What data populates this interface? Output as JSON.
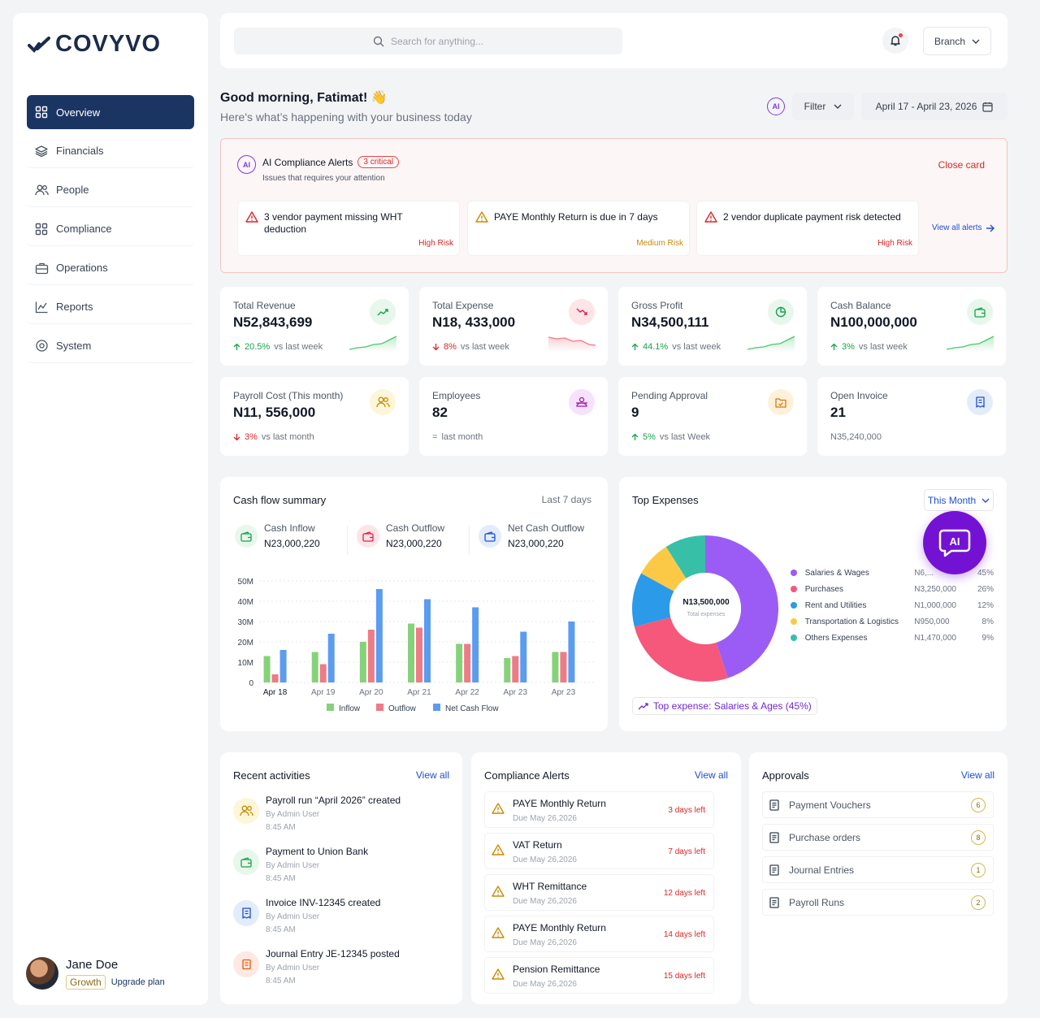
{
  "brand": {
    "name": "COVYVO",
    "accent": "#1b3563",
    "ai_color": "#7c3aed"
  },
  "sidebar": {
    "items": [
      {
        "label": "Overview",
        "icon": "grid-icon",
        "active": true
      },
      {
        "label": "Financials",
        "icon": "layers-icon"
      },
      {
        "label": "People",
        "icon": "users-icon"
      },
      {
        "label": "Compliance",
        "icon": "grid-icon"
      },
      {
        "label": "Operations",
        "icon": "briefcase-icon"
      },
      {
        "label": "Reports",
        "icon": "chart-line-icon"
      },
      {
        "label": "System",
        "icon": "settings-icon"
      }
    ]
  },
  "user": {
    "name": "Jane Doe",
    "plan": "Growth",
    "upgrade": "Upgrade plan"
  },
  "topbar": {
    "search_placeholder": "Search for anything...",
    "branch": "Branch"
  },
  "greeting": {
    "title": "Good morning, Fatimat! 👋",
    "subtitle": "Here's what’s happening with your business today"
  },
  "controls": {
    "ai": "AI",
    "filter": "Filter",
    "date_range": "April 17 - April 23, 2026"
  },
  "ai_alerts": {
    "ai": "AI",
    "title": "AI Compliance Alerts",
    "badge": "3 critical",
    "subtitle": "Issues that requires your attention",
    "close": "Close card",
    "view_all": "View all alerts",
    "items": [
      {
        "text": "3 vendor payment missing WHT deduction",
        "risk": "High Risk",
        "color": "#dc2626"
      },
      {
        "text": "PAYE Monthly Return is due in 7 days",
        "risk": "Medium Risk",
        "color": "#ca8a04"
      },
      {
        "text": "2 vendor duplicate payment risk detected",
        "risk": "High Risk",
        "color": "#dc2626"
      }
    ]
  },
  "kpis": [
    {
      "label": "Total Revenue",
      "value": "N52,843,699",
      "change": "20.5%",
      "note": "vs last week",
      "trend": "up",
      "icon": "trend-up-icon"
    },
    {
      "label": "Total Expense",
      "value": "N18, 433,000",
      "change": "8%",
      "note": "vs last week",
      "trend": "down",
      "icon": "trend-down-icon"
    },
    {
      "label": "Gross Profit",
      "value": "N34,500,111",
      "change": "44.1%",
      "note": "vs last week",
      "trend": "up",
      "icon": "pie-icon"
    },
    {
      "label": "Cash Balance",
      "value": "N100,000,000",
      "change": "3%",
      "note": "vs last week",
      "trend": "up",
      "icon": "wallet-icon"
    },
    {
      "label": "Payroll Cost (This month)",
      "value": "N11, 556,000",
      "change": "3%",
      "note": "vs last month",
      "trend": "down",
      "icon": "users-icon"
    },
    {
      "label": "Employees",
      "value": "82",
      "change": "=",
      "note": "last month",
      "trend": "flat",
      "icon": "employees-icon"
    },
    {
      "label": "Pending Approval",
      "value": "9",
      "change": "5%",
      "note": "vs last Week",
      "trend": "up",
      "icon": "folder-check-icon"
    },
    {
      "label": "Open Invoice",
      "value": "21",
      "change": "",
      "note": "N35,240,000",
      "trend": "none",
      "icon": "invoice-icon"
    }
  ],
  "cashflow": {
    "title": "Cash flow summary",
    "range": "Last 7 days",
    "stats": [
      {
        "label": "Cash Inflow",
        "value": "N23,000,220"
      },
      {
        "label": "Cash Outflow",
        "value": "N23,000,220"
      },
      {
        "label": "Net Cash Outflow",
        "value": "N23,000,220"
      }
    ]
  },
  "chart_data": {
    "type": "bar",
    "categories": [
      "Apr 18",
      "Apr 19",
      "Apr 20",
      "Apr 21",
      "Apr 22",
      "Apr 23",
      "Apr 23"
    ],
    "series": [
      {
        "name": "Inflow",
        "values": [
          13,
          15,
          20,
          29,
          19,
          12,
          15
        ],
        "color": "#86d27a"
      },
      {
        "name": "Outflow",
        "values": [
          4,
          9,
          26,
          27,
          19,
          13,
          15
        ],
        "color": "#ef7b86"
      },
      {
        "name": "Net Cash Flow",
        "values": [
          16,
          24,
          46,
          41,
          37,
          25,
          30
        ],
        "color": "#5b9cf1"
      }
    ],
    "yticks": [
      "0",
      "10M",
      "20M",
      "30M",
      "40M",
      "50M"
    ],
    "ylim": [
      0,
      50
    ],
    "legend": "bottom"
  },
  "top_expenses": {
    "title": "Top Expenses",
    "period": "This Month",
    "center_value": "N13,500,000",
    "center_label": "Total expenses",
    "insight": "Top expense: Salaries & Ages (45%)",
    "ai": "AI",
    "slices": [
      {
        "name": "Salaries & Wages",
        "value": "N6,...",
        "pct": "45%",
        "share": 45,
        "color": "#9b5cf6"
      },
      {
        "name": "Purchases",
        "value": "N3,250,000",
        "pct": "26%",
        "share": 26,
        "color": "#f5587a"
      },
      {
        "name": "Rent and Utilities",
        "value": "N1,000,000",
        "pct": "12%",
        "share": 12,
        "color": "#2b9ae8"
      },
      {
        "name": "Transportation & Logistics",
        "value": "N950,000",
        "pct": "8%",
        "share": 8,
        "color": "#fbc945"
      },
      {
        "name": "Others Expenses",
        "value": "N1,470,000",
        "pct": "9%",
        "share": 9,
        "color": "#38bfa8"
      }
    ]
  },
  "recent": {
    "title": "Recent activities",
    "view_all": "View all",
    "items": [
      {
        "title": "Payroll run “April 2026” created",
        "by": "By Admin User",
        "time": "8:45 AM"
      },
      {
        "title": "Payment to Union Bank",
        "by": "By Admin User",
        "time": "8:45 AM"
      },
      {
        "title": "Invoice INV-12345 created",
        "by": "By Admin User",
        "time": "8:45 AM"
      },
      {
        "title": "Journal Entry JE-12345 posted",
        "by": "By Admin User",
        "time": "8:45 AM"
      }
    ]
  },
  "compliance": {
    "title": "Compliance Alerts",
    "view_all": "View all",
    "items": [
      {
        "title": "PAYE Monthly Return",
        "due": "Due May 26,2026",
        "left": "3 days left"
      },
      {
        "title": "VAT Return",
        "due": "Due May 26,2026",
        "left": "7 days left"
      },
      {
        "title": "WHT Remittance",
        "due": "Due May 26,2026",
        "left": "12 days left"
      },
      {
        "title": "PAYE Monthly Return",
        "due": "Due May 26,2026",
        "left": "14 days left"
      },
      {
        "title": "Pension Remittance",
        "due": "Due May 26,2026",
        "left": "15 days left"
      }
    ]
  },
  "approvals": {
    "title": "Approvals",
    "view_all": "View all",
    "items": [
      {
        "name": "Payment Vouchers",
        "count": "6"
      },
      {
        "name": "Purchase orders",
        "count": "8"
      },
      {
        "name": "Journal Entries",
        "count": "1"
      },
      {
        "name": "Payroll Runs",
        "count": "2"
      }
    ]
  }
}
